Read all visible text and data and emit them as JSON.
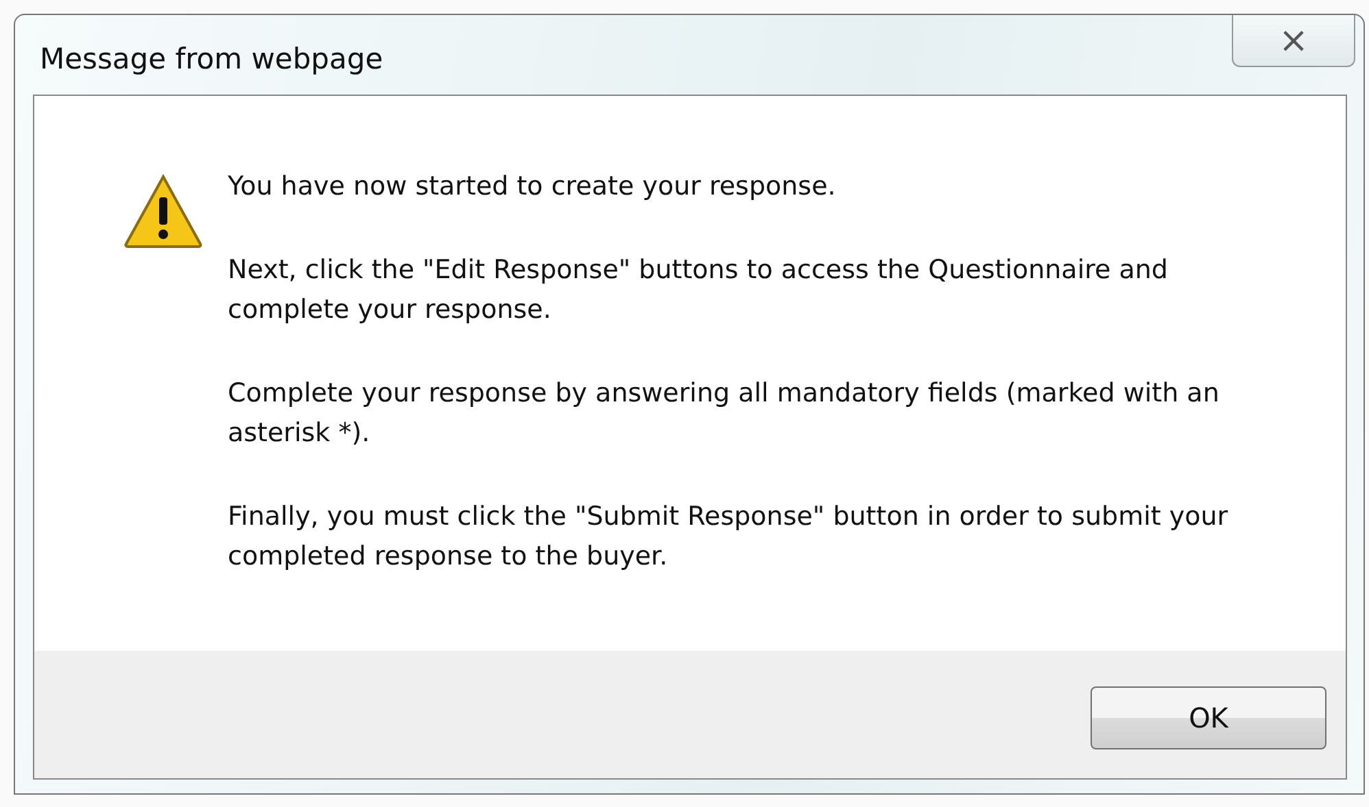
{
  "window": {
    "title": "Message from webpage",
    "close_label": "×"
  },
  "message": {
    "paragraphs": [
      "You have now started to create your response.",
      "Next, click the \"Edit Response\" buttons to access the Questionnaire and complete your response.",
      "Complete your response by answering all mandatory fields (marked with an asterisk *).",
      "Finally, you must click the \"Submit Response\" button in order to submit your completed response to the buyer."
    ]
  },
  "buttons": [
    "OK"
  ]
}
